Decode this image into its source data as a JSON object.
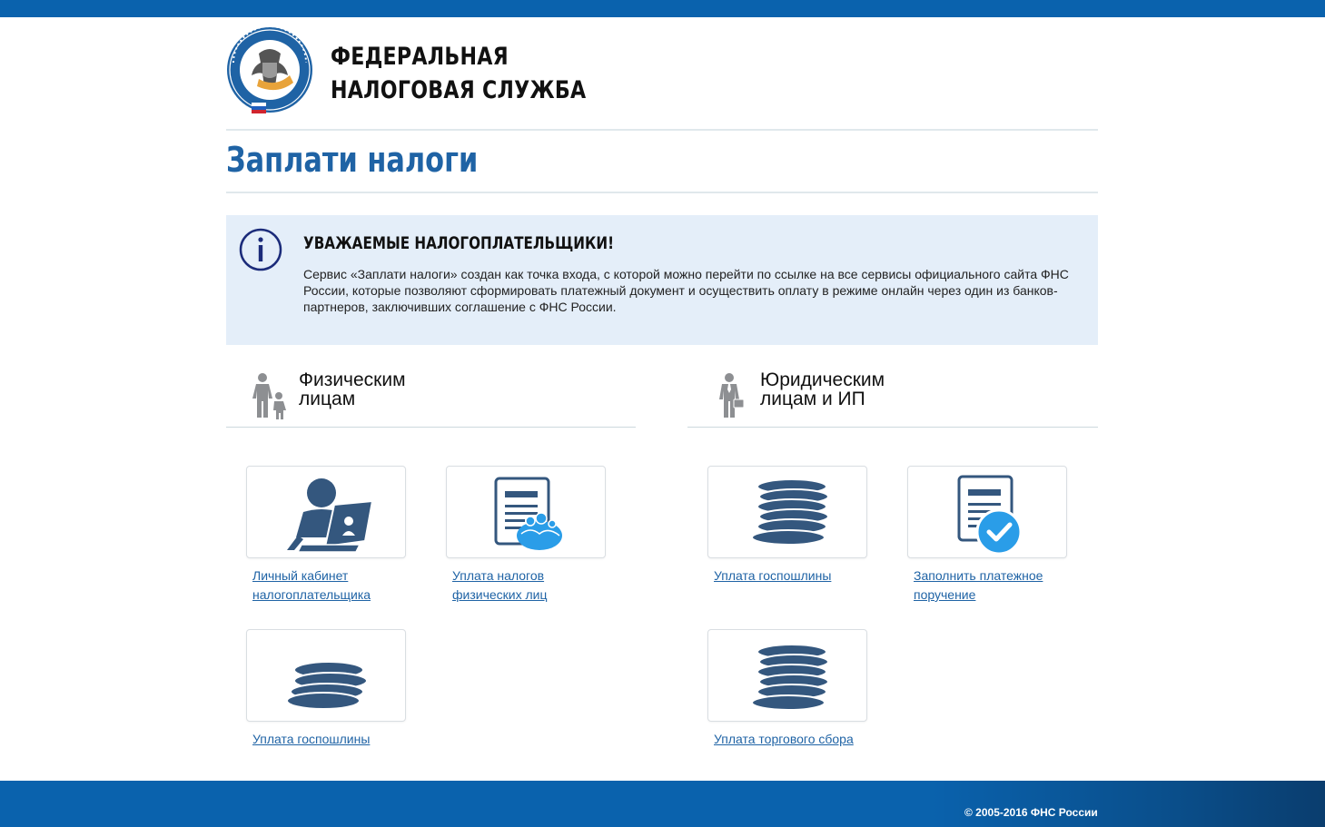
{
  "header": {
    "org_line1": "ФЕДЕРАЛЬНАЯ",
    "org_line2": "НАЛОГОВАЯ СЛУЖБА",
    "emblem_icon": "fns-emblem-icon"
  },
  "page": {
    "title": "Заплати налоги"
  },
  "notice": {
    "icon": "info-icon",
    "title": "УВАЖАЕМЫЕ НАЛОГОПЛАТЕЛЬЩИКИ!",
    "text": "Сервис «Заплати налоги» создан как точка входа, с которой можно перейти по ссылке на все сервисы официального сайта ФНС России, которые позволяют сформировать платежный документ и осуществить оплату в режиме онлайн через один из банков-партнеров, заключивших соглашение с ФНС России."
  },
  "sections": {
    "individuals": {
      "line1": "Физическим",
      "line2": "лицам",
      "icon": "family-icon",
      "tiles": [
        {
          "label": "Личный кабинет налогоплательщика",
          "icon": "user-laptop-icon"
        },
        {
          "label": "Уплата налогов физических лиц",
          "icon": "document-people-icon"
        },
        {
          "label": "Уплата госпошлины",
          "icon": "coins-small-icon"
        }
      ]
    },
    "legal": {
      "line1": "Юридическим",
      "line2": "лицам и ИП",
      "icon": "businessman-icon",
      "tiles": [
        {
          "label": "Уплата госпошлины",
          "icon": "coins-stack-icon"
        },
        {
          "label": "Заполнить платежное поручение",
          "icon": "document-check-icon"
        },
        {
          "label": "Уплата торгового сбора",
          "icon": "coins-stack-icon"
        }
      ]
    }
  },
  "footer": {
    "copyright": "© 2005-2016 ФНС России"
  },
  "colors": {
    "brand_blue": "#0a62ad",
    "title_blue": "#1f63a5",
    "icon_navy": "#34577e",
    "accent_light_blue": "#2a9de8",
    "notice_bg": "#e4eef9"
  }
}
